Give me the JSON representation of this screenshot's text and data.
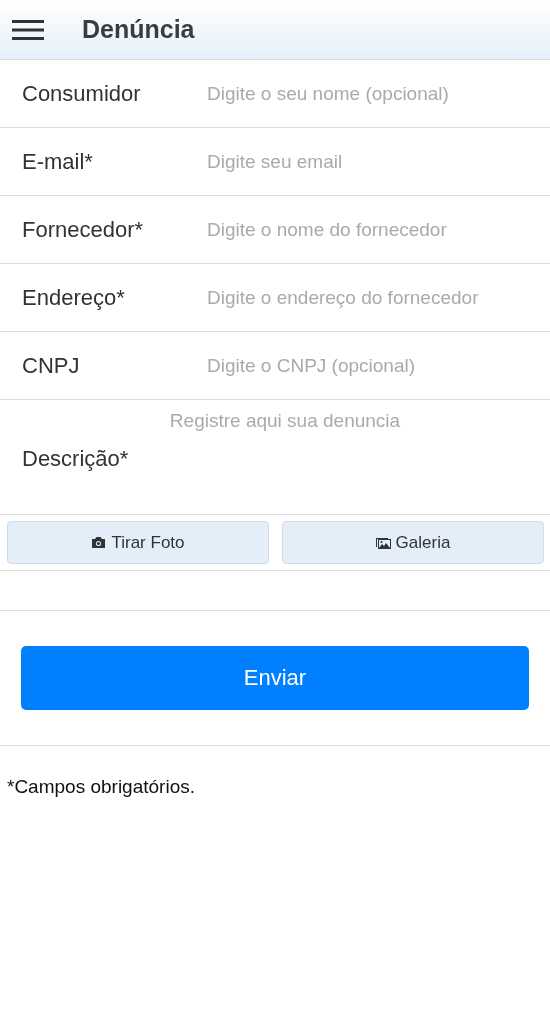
{
  "header": {
    "title": "Denúncia"
  },
  "fields": [
    {
      "label": "Consumidor",
      "placeholder": "Digite o seu nome (opcional)"
    },
    {
      "label": "E-mail*",
      "placeholder": "Digite seu email"
    },
    {
      "label": "Fornecedor*",
      "placeholder": "Digite o nome do fornecedor"
    },
    {
      "label": "Endereço*",
      "placeholder": "Digite o endereço do fornecedor"
    },
    {
      "label": "CNPJ",
      "placeholder": "Digite o CNPJ (opcional)"
    }
  ],
  "description": {
    "label": "Descrição*",
    "placeholder": "Registre aqui sua denuncia"
  },
  "photo_buttons": [
    {
      "kind": "camera",
      "label": "Tirar Foto"
    },
    {
      "kind": "gallery",
      "label": "Galeria"
    }
  ],
  "submit": {
    "label": "Enviar"
  },
  "note": "*Campos obrigatórios."
}
